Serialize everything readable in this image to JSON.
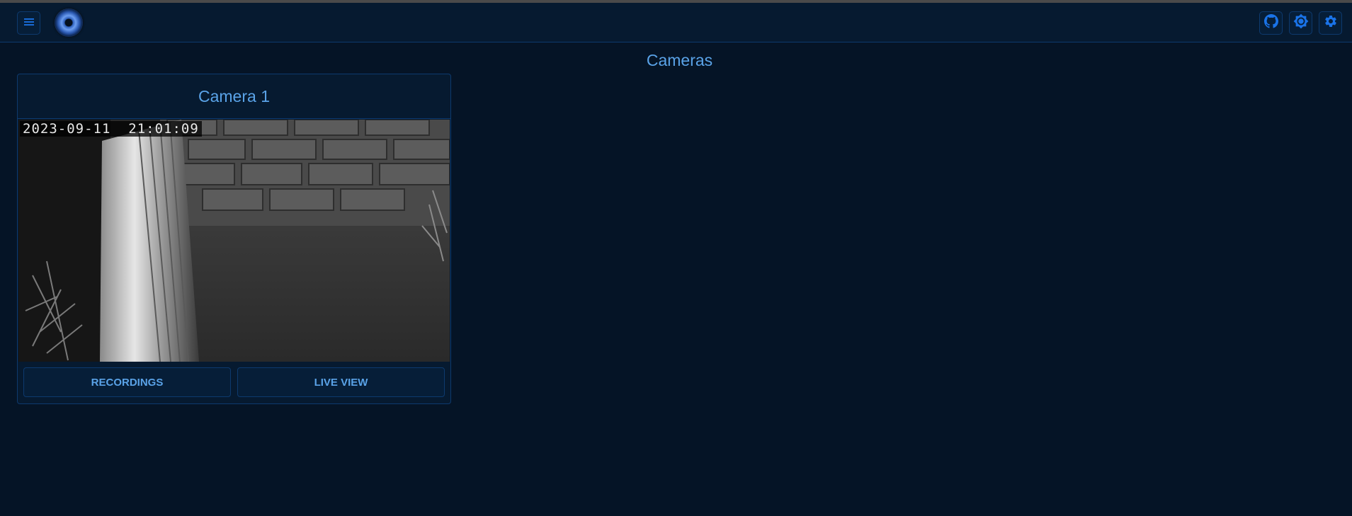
{
  "page": {
    "title": "Cameras"
  },
  "appbar": {
    "menu_icon": "menu-icon",
    "logo": "app-logo",
    "actions": [
      "github-icon",
      "brightness-icon",
      "settings-icon"
    ]
  },
  "cameras": [
    {
      "name": "Camera 1",
      "snapshot_timestamp": "2023-09-11  21:01:09",
      "buttons": {
        "recordings": "RECORDINGS",
        "live_view": "LIVE VIEW"
      }
    }
  ],
  "colors": {
    "background": "#051426",
    "accent": "#5aa3e8",
    "icon": "#1a73e8",
    "border": "#0d3a6e"
  }
}
